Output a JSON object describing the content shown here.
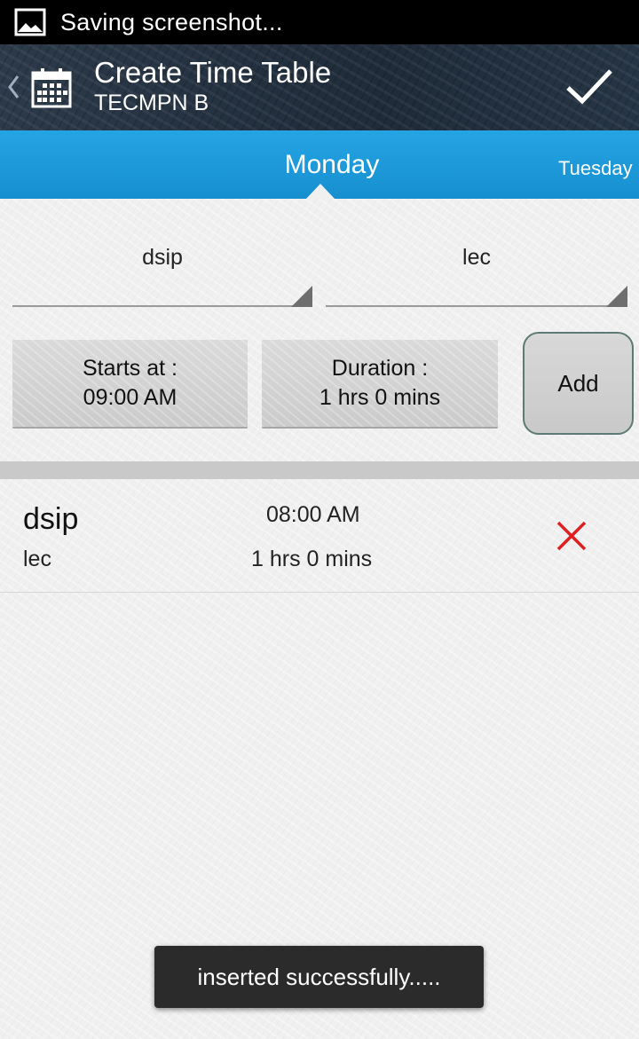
{
  "status_bar": {
    "text": "Saving screenshot...",
    "icon": "image-icon"
  },
  "action_bar": {
    "title": "Create Time Table",
    "subtitle": "TECMPN B",
    "up_icon": "chevron-left-icon",
    "app_icon": "calendar-icon",
    "done_icon": "checkmark-icon"
  },
  "tabs": {
    "active": "Monday",
    "next": "Tuesday"
  },
  "form": {
    "subject_value": "dsip",
    "type_value": "lec",
    "starts_label": "Starts at :",
    "starts_value": "09:00 AM",
    "duration_label": "Duration :",
    "duration_value": "1 hrs 0 mins",
    "add_label": "Add"
  },
  "entries": [
    {
      "subject": "dsip",
      "type": "lec",
      "time": "08:00 AM",
      "duration": "1 hrs 0 mins",
      "delete_icon": "close-icon"
    }
  ],
  "toast": {
    "message": "inserted successfully....."
  },
  "colors": {
    "tab_blue": "#1e9ad8",
    "action_bar": "#22303f",
    "delete_red": "#e02020"
  }
}
